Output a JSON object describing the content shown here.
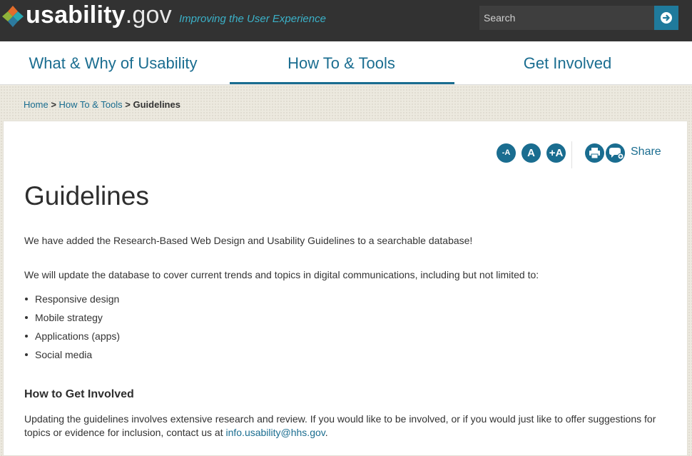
{
  "header": {
    "logo_bold": "usability",
    "logo_suffix": ".gov",
    "tagline": "Improving the User Experience",
    "search_placeholder": "Search"
  },
  "nav": {
    "tabs": [
      {
        "label": "What & Why of Usability",
        "active": false
      },
      {
        "label": "How To & Tools",
        "active": true
      },
      {
        "label": "Get Involved",
        "active": false
      }
    ]
  },
  "breadcrumb": {
    "home": "Home",
    "separator": ">",
    "parent": "How To & Tools",
    "current": "Guidelines"
  },
  "toolbar": {
    "decrease_text": "-A",
    "reset_text": "A",
    "increase_text": "+A",
    "share_label": "Share"
  },
  "main": {
    "title": "Guidelines",
    "intro": "We have added the Research-Based Web Design and Usability Guidelines to a searchable database!",
    "update_text": "We will update the database to cover current trends and topics in digital communications, including but not limited to:",
    "topics": [
      "Responsive design",
      "Mobile strategy",
      "Applications (apps)",
      "Social media"
    ],
    "involved_heading": "How to Get Involved",
    "involved_text": "Updating the guidelines involves extensive research and review. If you would like to be involved, or if you would just like to offer suggestions for topics or evidence for inclusion, contact us at ",
    "contact_email": "info.usability@hhs.gov",
    "involved_end": "."
  },
  "colors": {
    "header_bg": "#323232",
    "accent": "#1a6d90",
    "tagline": "#3bb1c8"
  }
}
